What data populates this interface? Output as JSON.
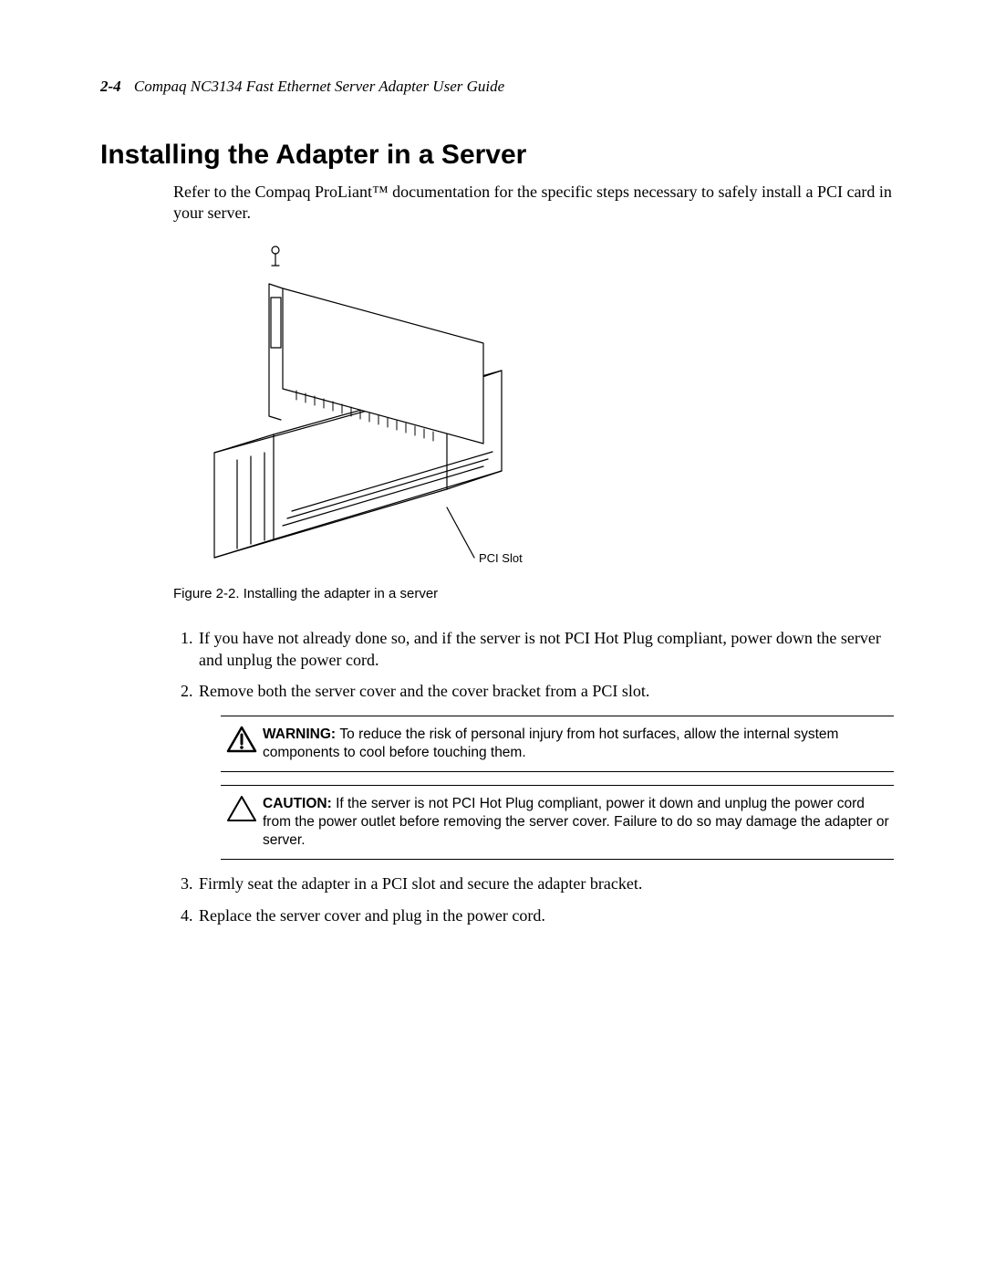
{
  "header": {
    "page_number": "2-4",
    "doc_title": "Compaq NC3134 Fast Ethernet Server Adapter User Guide"
  },
  "section": {
    "title": "Installing the Adapter in a Server",
    "intro": "Refer to the Compaq ProLiant™ documentation for the specific steps necessary to safely install a PCI card in your server."
  },
  "figure": {
    "callout": "PCI Slot",
    "caption": "Figure 2-2.  Installing the adapter in a server"
  },
  "steps": {
    "s1": "If you have not already done so, and if the server is not PCI Hot Plug compliant, power down the server and unplug the power cord.",
    "s2": "Remove both the server cover and the cover bracket from a PCI slot.",
    "s3": "Firmly seat the adapter in a PCI slot and secure the adapter bracket.",
    "s4": "Replace the server cover and plug in the power cord."
  },
  "warning": {
    "label": "WARNING:  ",
    "text": "To reduce the risk of personal injury from hot surfaces, allow the internal system components to cool before touching them."
  },
  "caution": {
    "label": "CAUTION:  ",
    "text": "If the server is not PCI Hot Plug compliant, power it down and unplug the power cord from the power outlet before removing the server cover. Failure to do so may damage the adapter or server."
  }
}
